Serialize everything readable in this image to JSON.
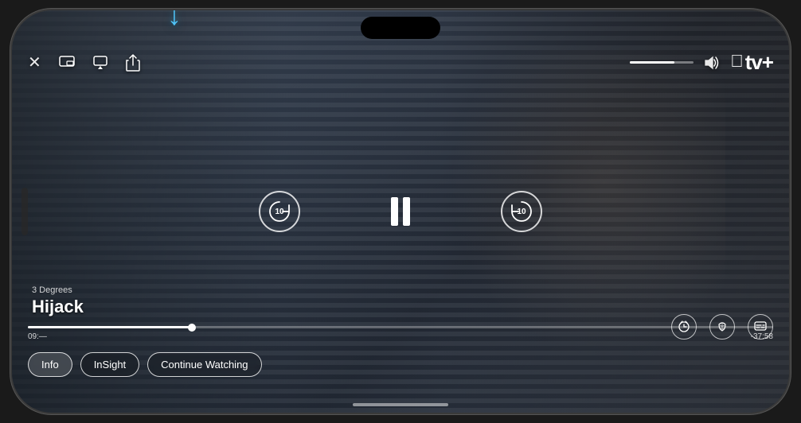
{
  "phone": {
    "title": "Apple TV+ Video Player"
  },
  "top_controls": {
    "close_label": "✕",
    "pip_label": "⧉",
    "airplay_label": "⬛",
    "share_label": "↑",
    "volume_icon": "🔊"
  },
  "apple_tv": {
    "logo": "",
    "brand": "tv+"
  },
  "arrow": {
    "symbol": "↓",
    "color": "#4fc3f7"
  },
  "show": {
    "season": "3 Degrees",
    "title": "Hijack"
  },
  "playback": {
    "rewind_label": "10",
    "pause_label": "⏸",
    "forward_label": "10",
    "current_time": "09:—",
    "remaining_time": "-37:58",
    "progress_percent": 22
  },
  "bottom_right_controls": {
    "speed_icon": "⏱",
    "audio_icon": "🎵",
    "subtitles_icon": "💬"
  },
  "pills": {
    "info_label": "Info",
    "insight_label": "InSight",
    "continue_label": "Continue Watching"
  },
  "home_indicator": true
}
